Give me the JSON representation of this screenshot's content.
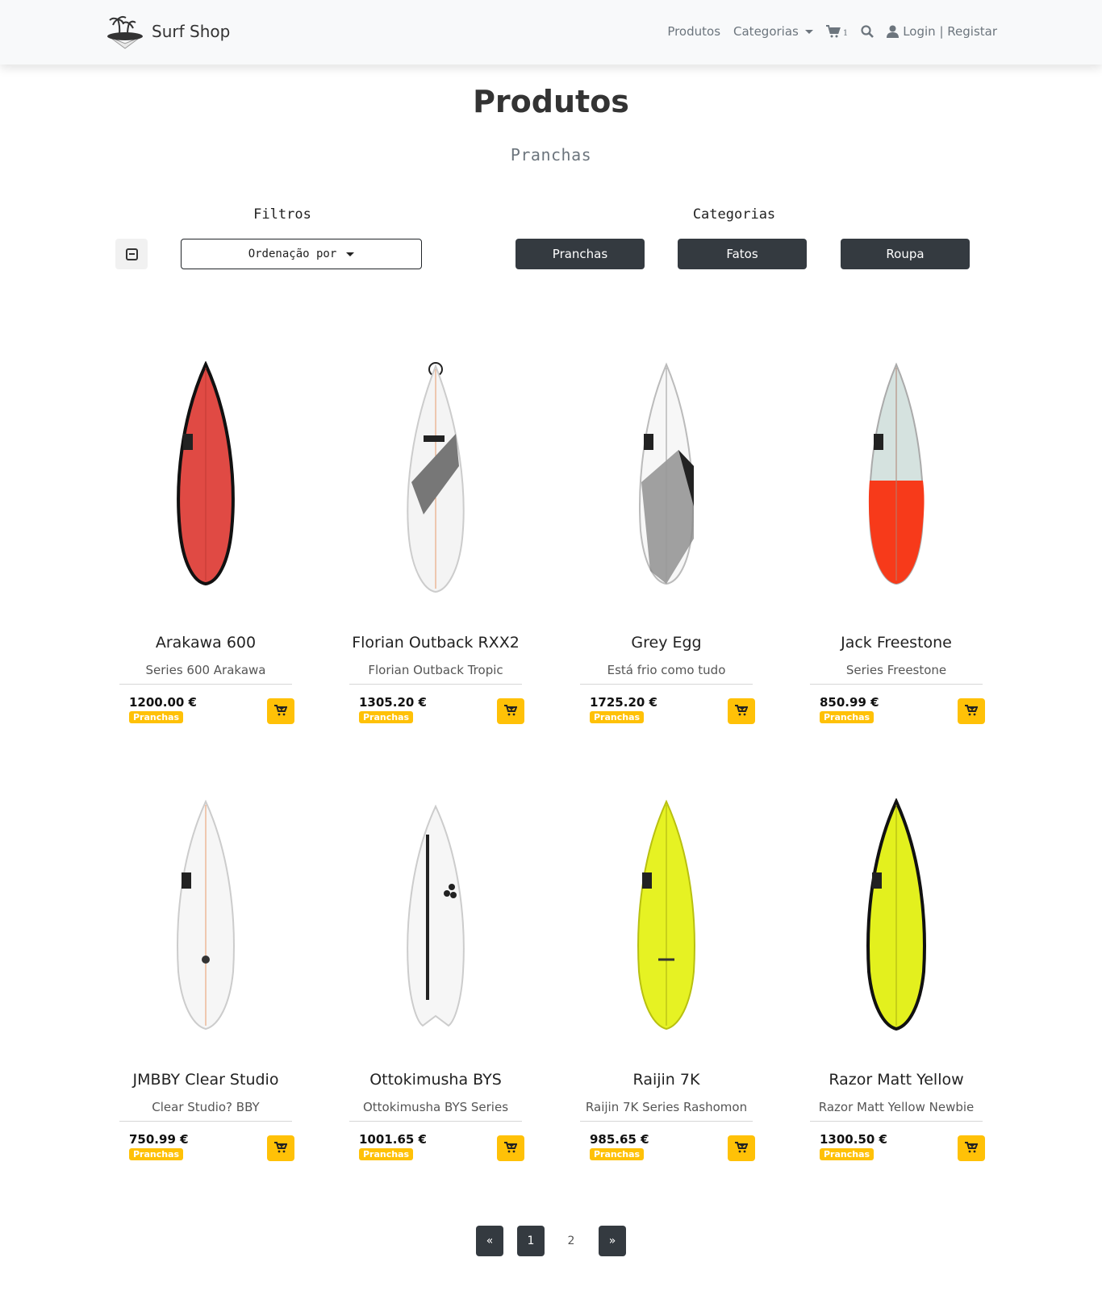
{
  "navbar": {
    "brand": "Surf Shop",
    "produtos": "Produtos",
    "categorias": "Categorias",
    "cart_count": "1",
    "login": "Login | Registar"
  },
  "header": {
    "title": "Produtos",
    "subtitle": "Pranchas"
  },
  "filters": {
    "label": "Filtros",
    "sort_label": "Ordenação por"
  },
  "categories": {
    "label": "Categorias",
    "items": [
      "Pranchas",
      "Fatos",
      "Roupa"
    ]
  },
  "products": [
    {
      "name": "Arakawa 600",
      "desc": "Series 600 Arakawa",
      "price": "1200.00 €",
      "badge": "Pranchas"
    },
    {
      "name": "Florian Outback RXX2",
      "desc": "Florian Outback Tropic",
      "price": "1305.20 €",
      "badge": "Pranchas"
    },
    {
      "name": "Grey Egg",
      "desc": "Está frio como tudo",
      "price": "1725.20 €",
      "badge": "Pranchas"
    },
    {
      "name": "Jack Freestone",
      "desc": "Series Freestone",
      "price": "850.99 €",
      "badge": "Pranchas"
    },
    {
      "name": "JMBBY Clear Studio",
      "desc": "Clear Studio? BBY",
      "price": "750.99 €",
      "badge": "Pranchas"
    },
    {
      "name": "Ottokimusha BYS",
      "desc": "Ottokimusha BYS Series",
      "price": "1001.65 €",
      "badge": "Pranchas"
    },
    {
      "name": "Raijin 7K",
      "desc": "Raijin 7K Series Rashomon",
      "price": "985.65 €",
      "badge": "Pranchas"
    },
    {
      "name": "Razor Matt Yellow",
      "desc": "Razor Matt Yellow Newbie",
      "price": "1300.50 €",
      "badge": "Pranchas"
    }
  ],
  "pagination": {
    "prev": "«",
    "pages": [
      "1",
      "2"
    ],
    "next": "»"
  },
  "colors": {
    "accent": "#ffc107",
    "dark": "#343a40"
  }
}
